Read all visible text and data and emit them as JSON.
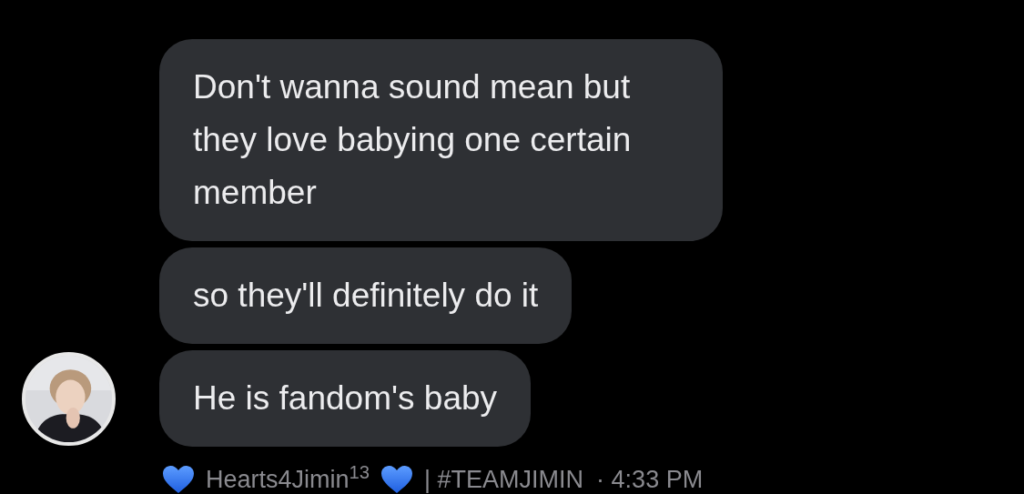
{
  "messages": [
    {
      "text": "Don't wanna sound mean but they love babying one certain member",
      "show_avatar": false
    },
    {
      "text": "so they'll definitely do it",
      "show_avatar": false
    },
    {
      "text": "He is fandom's baby",
      "show_avatar": true
    }
  ],
  "footer": {
    "sender": "Hearts4Jimin$^{13}$",
    "tag": "| #TEAMJIMIN",
    "time": "· 4:33 PM"
  }
}
